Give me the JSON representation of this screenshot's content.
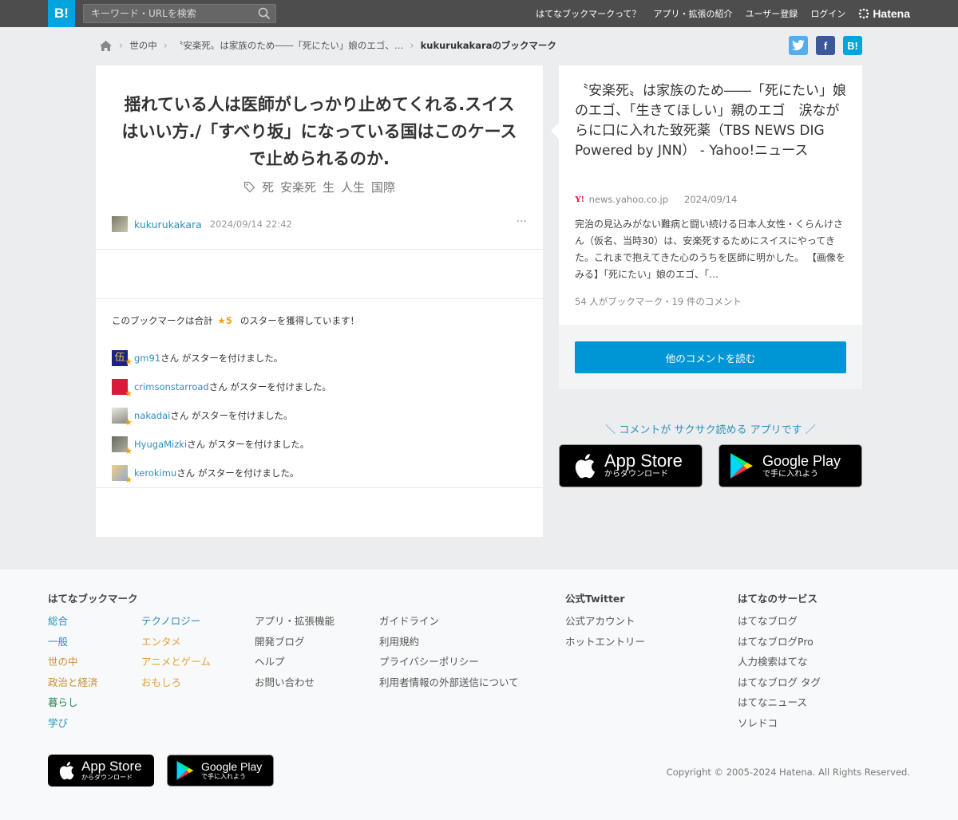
{
  "topbar": {
    "logo": "B!",
    "search_placeholder": "キーワード・URLを検索",
    "nav": [
      "はてなブックマークって？",
      "アプリ・拡張の紹介",
      "ユーザー登録",
      "ログイン"
    ],
    "hatena": "Hatena"
  },
  "breadcrumb": {
    "items": [
      "世の中",
      "〝安楽死〟は家族のため――「死にたい」娘のエゴ、…"
    ],
    "current": "kukurukakaraのブックマーク"
  },
  "share": {
    "hatena": "B!",
    "facebook": "f"
  },
  "bookmark": {
    "comment": "揺れている人は医師がしっかり止めてくれる.スイスはいい方./「すべり坂」になっている国はこのケースで止められるのか.",
    "tags": [
      "死",
      "安楽死",
      "生",
      "人生",
      "国際"
    ],
    "user": "kukurukakara",
    "datetime": "2024/09/14 22:42",
    "more": "···"
  },
  "stars": {
    "summary_pre": "このブックマークは合計",
    "count": "★5",
    "summary_post": "のスターを獲得しています！",
    "suffix": "さん がスターを付けました。",
    "users": [
      {
        "name": "gm91",
        "color": "#1a237e"
      },
      {
        "name": "crimsonstarroad",
        "color": "#d81b3a"
      },
      {
        "name": "nakadai",
        "color": "#b0b0a8"
      },
      {
        "name": "HyugaMizki",
        "color": "#8a8a80"
      },
      {
        "name": "kerokimu",
        "color": "#a8b8d8"
      }
    ]
  },
  "entry": {
    "title": "〝安楽死〟は家族のため――「死にたい」娘のエゴ、「生きてほしい」親のエゴ　涙ながらに口に入れた致死薬（TBS NEWS DIG Powered by JNN） - Yahoo!ニュース",
    "site_icon": "Y!",
    "site": "news.yahoo.co.jp",
    "date": "2024/09/14",
    "description": "完治の見込みがない難病と闘い続ける日本人女性・くらんけさん（仮名、当時30）は、安楽死するためにスイスにやってきた。これまで抱えてきた心のうちを医師に明かした。 【画像をみる】「死にたい」娘のエゴ、「…",
    "stats": "54 人がブックマーク・19 件のコメント",
    "read_button": "他のコメントを読む"
  },
  "promo": {
    "text": "＼ コメントが サクサク読める アプリです ／",
    "appstore_big": "App Store",
    "appstore_small": "からダウンロード",
    "googleplay_big": "Google Play",
    "googleplay_small": "で手に入れよう"
  },
  "footer": {
    "bookmark_heading": "はてなブックマーク",
    "cat1": [
      "総合",
      "一般",
      "世の中",
      "政治と経済",
      "暮らし",
      "学び"
    ],
    "cat2": [
      "テクノロジー",
      "エンタメ",
      "アニメとゲーム",
      "おもしろ"
    ],
    "links1": [
      "アプリ・拡張機能",
      "開発ブログ",
      "ヘルプ",
      "お問い合わせ"
    ],
    "links2": [
      "ガイドライン",
      "利用規約",
      "プライバシーポリシー",
      "利用者情報の外部送信について"
    ],
    "twitter_heading": "公式Twitter",
    "twitter": [
      "公式アカウント",
      "ホットエントリー"
    ],
    "services_heading": "はてなのサービス",
    "services": [
      "はてなブログ",
      "はてなブログPro",
      "人力検索はてな",
      "はてなブログ タグ",
      "はてなニュース",
      "ソレドコ"
    ],
    "copyright": "Copyright © 2005-2024 Hatena. All Rights Reserved."
  }
}
